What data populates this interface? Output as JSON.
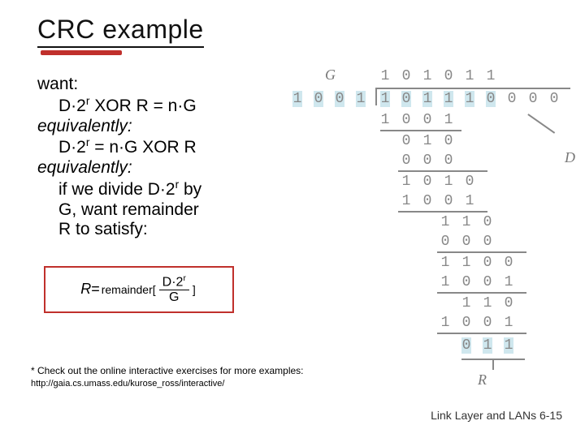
{
  "title": "CRC example",
  "body": {
    "want": "want:",
    "eq1_a": "D",
    "eq1_b": "2",
    "eq1_c": "r",
    "eq1_d": " XOR R = n",
    "eq1_e": "G",
    "equiv1": "equivalently:",
    "eq2_a": "D",
    "eq2_b": "2",
    "eq2_c": "r",
    "eq2_d": " = n",
    "eq2_e": "G XOR R",
    "equiv2": "equivalently:",
    "line3a": "if we divide D",
    "line3b": "2",
    "line3c": "r",
    "line3d": " by",
    "line4": "G, want remainder",
    "line5": "R to satisfy:"
  },
  "formula": {
    "R": "R",
    "eq": " = ",
    "rem_open": "remainder[",
    "num_a": "D",
    "num_b": "2",
    "num_c": "r",
    "den": "G",
    "close": "]"
  },
  "footnote": {
    "text": "* Check out the online interactive exercises for more examples: ",
    "url": "http://gaia.cs.umass.edu/kurose_ross/interactive/"
  },
  "slidenum": "Link Layer and LANs  6-15",
  "fig": {
    "G": "G",
    "D": "D",
    "R": "R",
    "quotient": [
      "1",
      "0",
      "1",
      "0",
      "1",
      "1"
    ],
    "divisor": [
      "1",
      "0",
      "0",
      "1"
    ],
    "dividend": [
      "1",
      "0",
      "1",
      "1",
      "1",
      "0",
      "0",
      "0",
      "0"
    ],
    "s1": [
      "1",
      "0",
      "0",
      "1"
    ],
    "r1": [
      "0",
      "1",
      "0"
    ],
    "s2": [
      "0",
      "0",
      "0"
    ],
    "r2": [
      "1",
      "0",
      "1",
      "0"
    ],
    "s3": [
      "1",
      "0",
      "0",
      "1"
    ],
    "r3": [
      "1",
      "1",
      "0"
    ],
    "s4": [
      "0",
      "0",
      "0"
    ],
    "r4": [
      "1",
      "1",
      "0",
      "0"
    ],
    "s5": [
      "1",
      "0",
      "0",
      "1"
    ],
    "r5": [
      "1",
      "1",
      "0"
    ],
    "s6": [
      "1",
      "0",
      "0",
      "1"
    ],
    "rem": [
      "0",
      "1",
      "1"
    ]
  },
  "chart_data": {
    "type": "table",
    "title": "CRC long-division example",
    "divisor_G": [
      1,
      0,
      0,
      1
    ],
    "dividend_D2r": [
      1,
      0,
      1,
      1,
      1,
      0,
      0,
      0,
      0
    ],
    "quotient": [
      1,
      0,
      1,
      0,
      1,
      1
    ],
    "remainder_R": [
      0,
      1,
      1
    ],
    "steps": [
      {
        "bring_down_index": 0,
        "sub": [
          1,
          0,
          0,
          1
        ],
        "partial": [
          0,
          1,
          0
        ]
      },
      {
        "bring_down_index": 1,
        "sub": [
          0,
          0,
          0
        ],
        "partial": [
          1,
          0,
          1,
          0
        ]
      },
      {
        "bring_down_index": 2,
        "sub": [
          1,
          0,
          0,
          1
        ],
        "partial": [
          1,
          1,
          0
        ]
      },
      {
        "bring_down_index": 3,
        "sub": [
          0,
          0,
          0
        ],
        "partial": [
          1,
          1,
          0,
          0
        ]
      },
      {
        "bring_down_index": 4,
        "sub": [
          1,
          0,
          0,
          1
        ],
        "partial": [
          1,
          1,
          0
        ]
      },
      {
        "bring_down_index": 5,
        "sub": [
          1,
          0,
          0,
          1
        ],
        "partial": [
          0,
          1,
          1
        ]
      }
    ]
  }
}
